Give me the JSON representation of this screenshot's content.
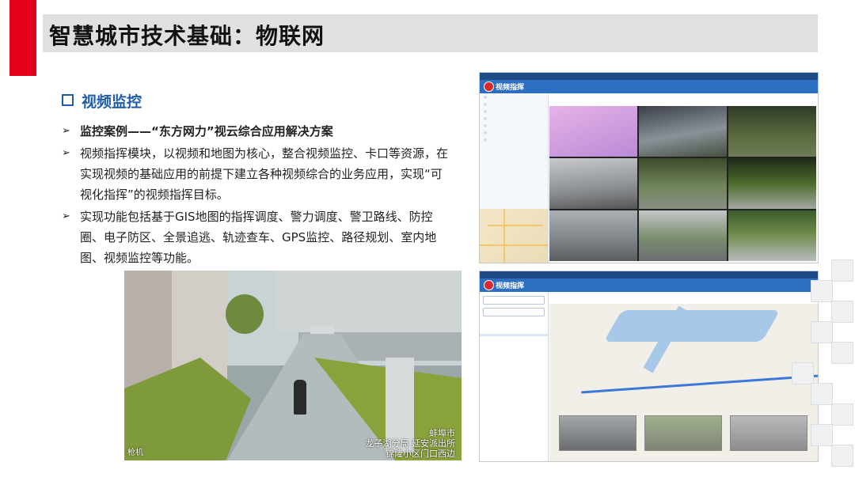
{
  "title": "智慧城市技术基础：物联网",
  "section_heading": "视频监控",
  "bullets": [
    "监控案例——“东方网力”视云综合应用解决方案",
    "视频指挥模块，以视频和地图为核心，整合视频监控、卡口等资源，在实现视频的基础应用的前提下建立各种视频综合的业务应用，实现“可视化指挥”的视频指挥目标。",
    "实现功能包括基于GIS地图的指挥调度、警力调度、警卫路线、防控圈、电子防区、全景追逃、轨迹查车、GPS监控、路径规划、室内地图、视频监控等功能。"
  ],
  "street_photo": {
    "caption_lines": [
      "蚌埠市",
      "龙子湖分局 延安派出所",
      "锦隆小区门口西边"
    ],
    "left_caption": "枪机"
  },
  "screenshot_top": {
    "header_title": "视频指挥"
  },
  "screenshot_bottom": {
    "header_title": "视频指挥"
  },
  "colors": {
    "accent_red": "#e2001a",
    "title_bar": "#e0e0e0",
    "section_blue": "#1f5da8",
    "app_header": "#2c6fc1"
  },
  "icons": {
    "section_marker": "hollow-square-icon",
    "bullet_marker": "arrow-bullet-icon"
  }
}
